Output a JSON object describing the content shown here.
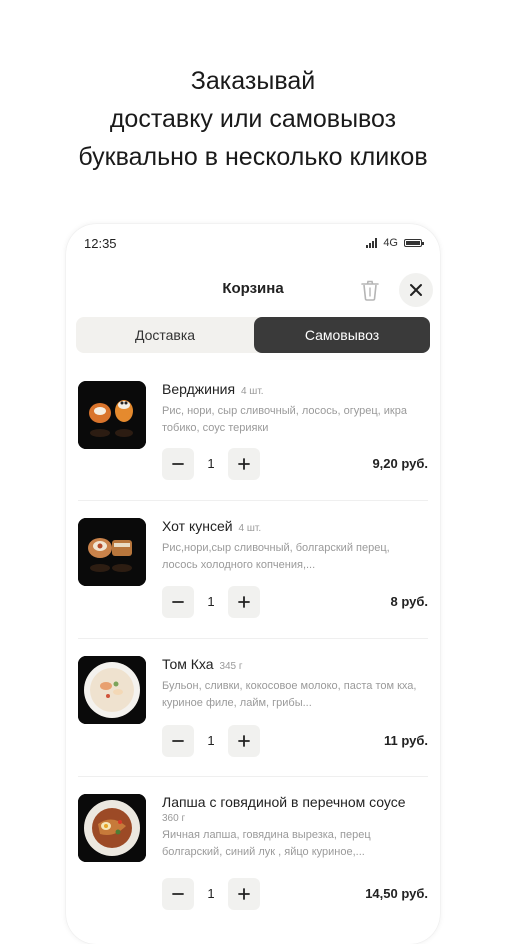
{
  "promo": {
    "line1": "Заказывай",
    "line2": "доставку или самовывоз",
    "line3": "буквально в несколько кликов"
  },
  "status_bar": {
    "time": "12:35",
    "network": "4G"
  },
  "header": {
    "title": "Корзина",
    "trash_icon": "trash-icon",
    "close_icon": "close-icon"
  },
  "tabs": [
    {
      "label": "Доставка",
      "active": false
    },
    {
      "label": "Самовывоз",
      "active": true
    }
  ],
  "items": [
    {
      "name": "Верджиния",
      "note": "4 шт.",
      "desc": "Рис, нори, сыр сливочный, лосось, огурец, икра тобико, соус терияки",
      "count": "1",
      "price": "9,20 руб."
    },
    {
      "name": "Хот кунсей",
      "note": "4 шт.",
      "desc": "Рис,нори,сыр сливочный, болгарский перец, лосось холодного копчения,...",
      "count": "1",
      "price": "8 руб."
    },
    {
      "name": "Том Кха",
      "note": "345 г",
      "desc": "Бульон, сливки, кокосовое молоко, паста том кха, куриное филе, лайм, грибы...",
      "count": "1",
      "price": "11 руб."
    },
    {
      "name": "Лапша с говядиной в перечном соусе",
      "note": "360 г",
      "desc": "Яичная лапша, говядина вырезка, перец болгарский, синий лук , яйцо куриное,...",
      "count": "1",
      "price": "14,50 руб."
    }
  ],
  "colors": {
    "active_tab_bg": "#3a3a3a",
    "tabs_bg": "#f2f1ee",
    "button_bg": "#f1f1ef",
    "muted_text": "#9a9a9a"
  }
}
